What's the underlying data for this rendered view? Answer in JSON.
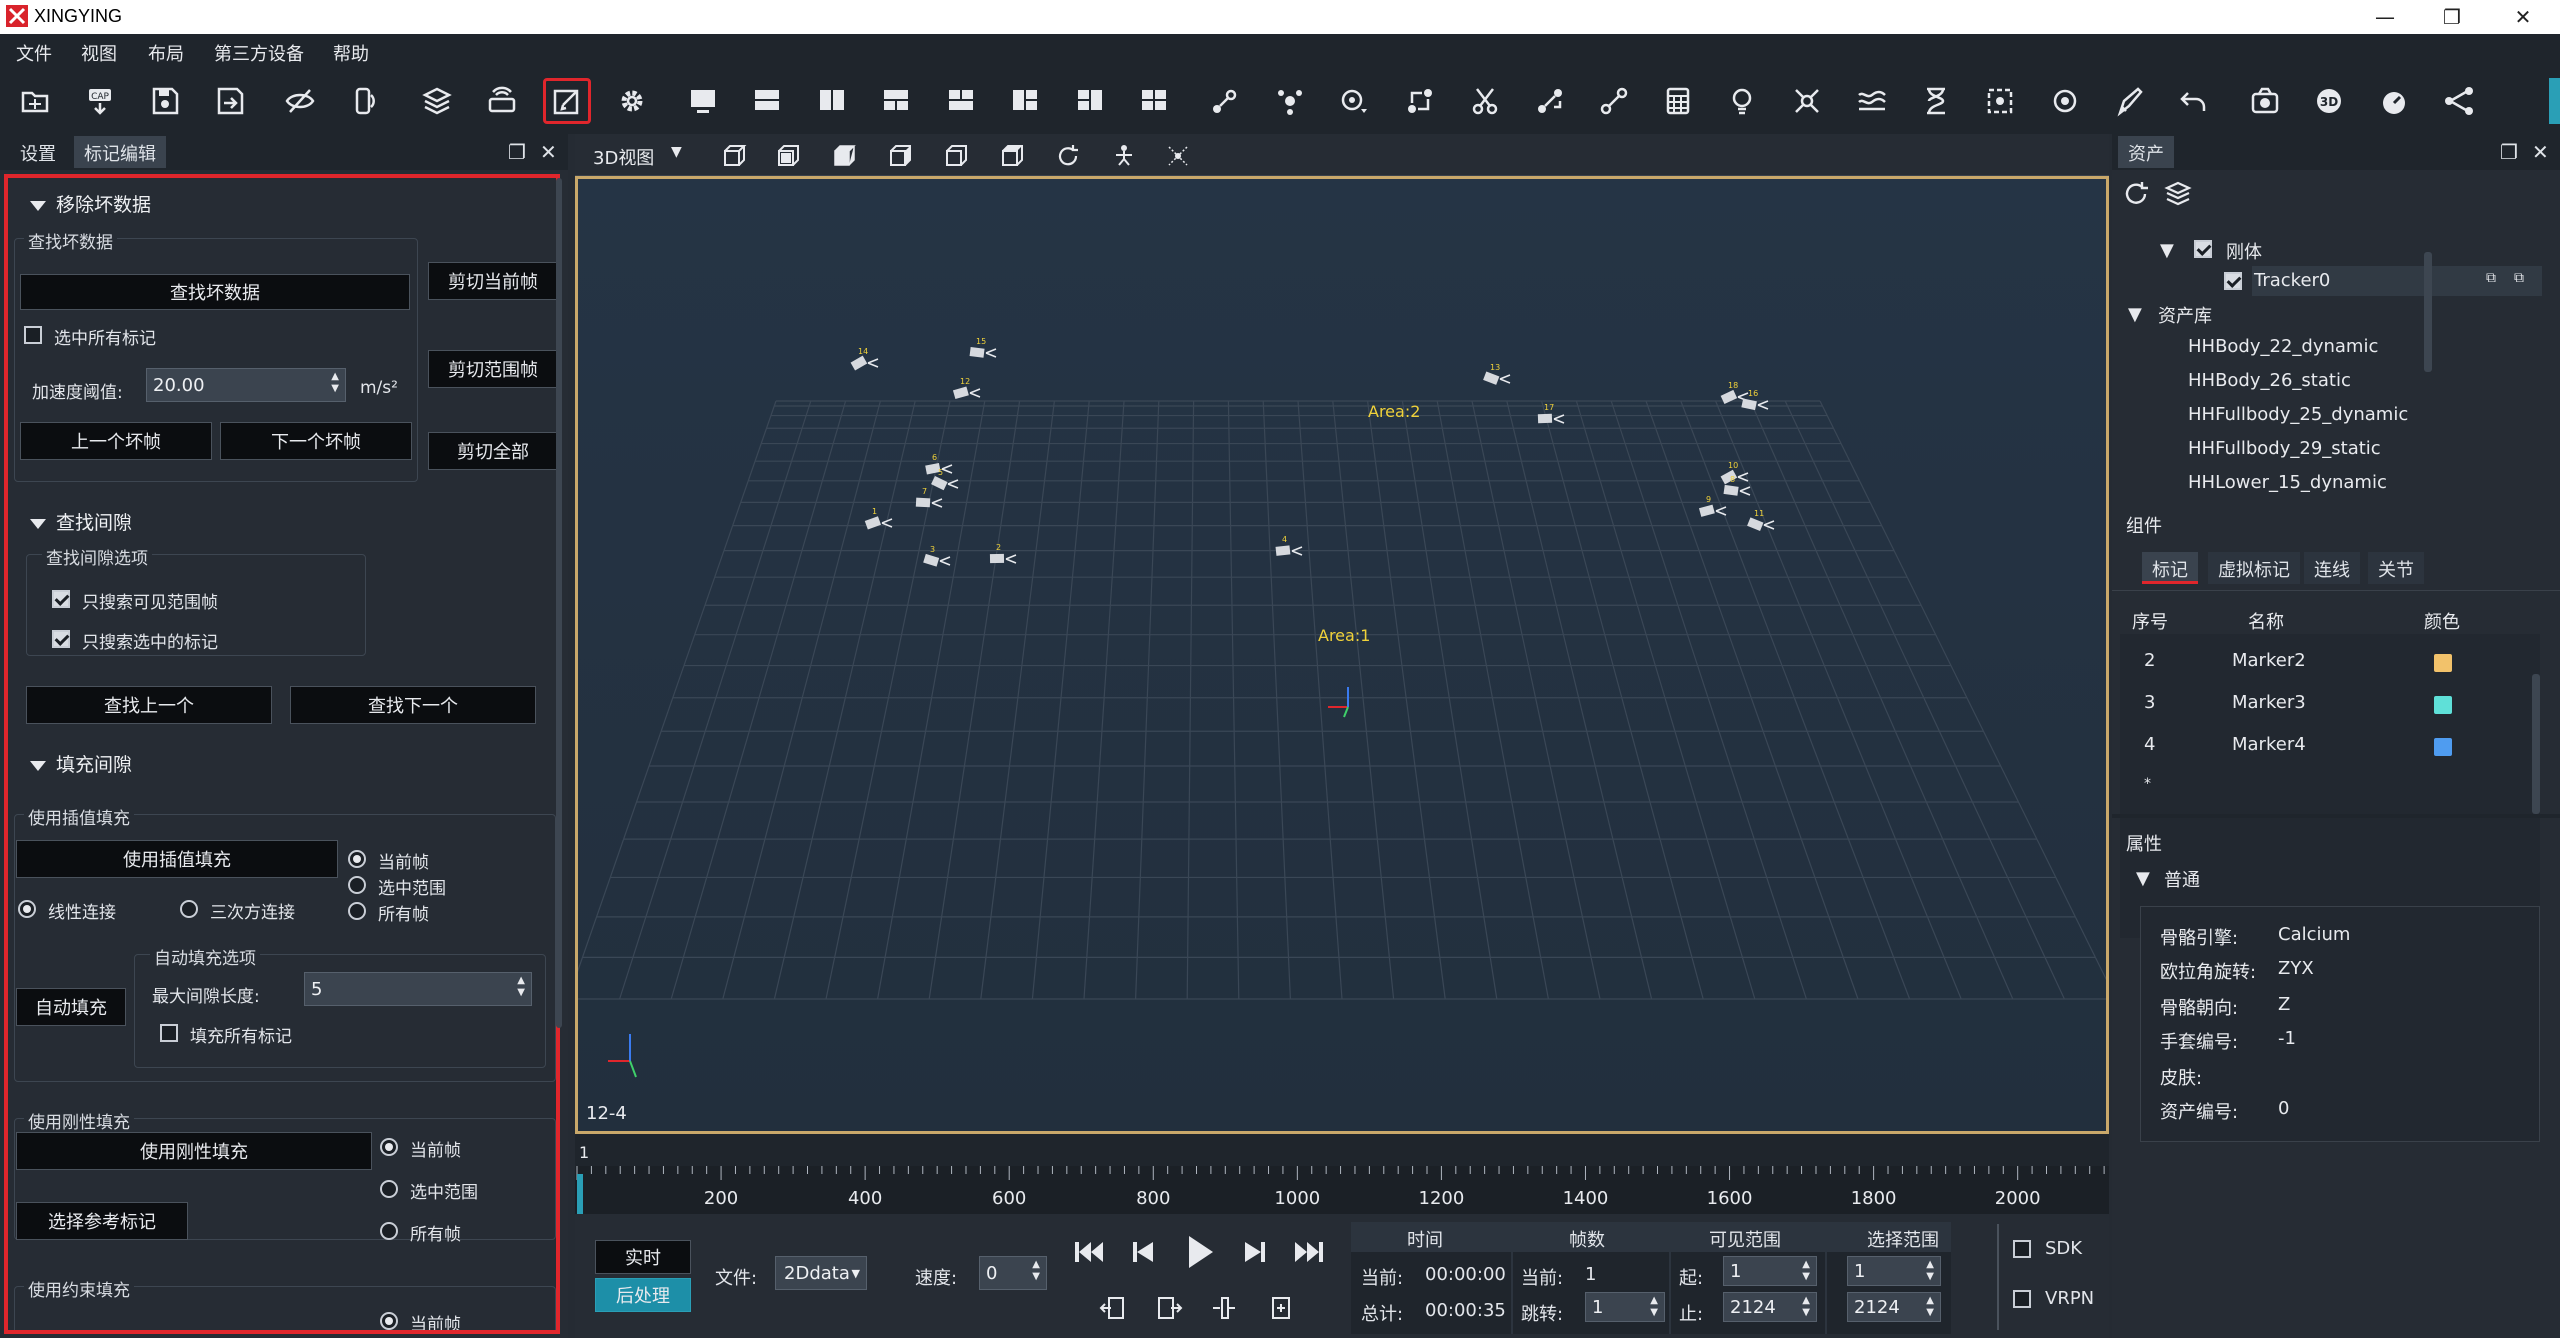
{
  "app": {
    "title": "XINGYING"
  },
  "window_controls": {
    "minimize": "—",
    "maximize": "❐",
    "close": "✕"
  },
  "menu": [
    "文件",
    "视图",
    "布局",
    "第三方设备",
    "帮助"
  ],
  "toolbar_icons": [
    "open-folder-icon",
    "cap-icon",
    "save-icon",
    "export-icon",
    "hide-icon",
    "device-icon",
    "layers-icon",
    "broadcast-icon",
    "edit-marker-icon",
    "settings-icon",
    "layout-single-icon",
    "layout-hsplit-icon",
    "layout-vsplit-icon",
    "layout-3a-icon",
    "layout-3b-icon",
    "layout-3c-icon",
    "layout-3d-icon",
    "layout-quad-icon",
    "link-marker-icon",
    "merge-icon",
    "track-icon",
    "swap-icon",
    "cut-icon",
    "join-icon",
    "connect-icon",
    "calculator-icon",
    "bulb-icon",
    "scatter-icon",
    "wave-icon",
    "hourglass-icon",
    "focus-icon",
    "record-icon",
    "pen-icon",
    "undo-icon",
    "camera-icon",
    "3d-icon",
    "speed-icon",
    "network-icon"
  ],
  "left_panel": {
    "tabs": [
      "设置",
      "标记编辑"
    ],
    "sections": {
      "remove_bad": {
        "title": "移除坏数据",
        "group_title": "查找坏数据",
        "find_button": "查找坏数据",
        "select_all_label": "选中所有标记",
        "accel_label": "加速度阈值:",
        "accel_value": "20.00",
        "accel_unit": "m/s²",
        "prev_button": "上一个坏帧",
        "next_button": "下一个坏帧",
        "cut_current": "剪切当前帧",
        "cut_range": "剪切范围帧",
        "cut_all": "剪切全部"
      },
      "find_gap": {
        "title": "查找间隙",
        "group_title": "查找间隙选项",
        "opt_visible": "只搜索可见范围帧",
        "opt_selected": "只搜索选中的标记",
        "prev_button": "查找上一个",
        "next_button": "查找下一个"
      },
      "fill_gap": {
        "title": "填充间隙",
        "interp_group": "使用插值填充",
        "interp_button": "使用插值填充",
        "linear": "线性连接",
        "cubic": "三次方连接",
        "current_frame": "当前帧",
        "selected_range": "选中范围",
        "all_frames": "所有帧",
        "auto_group": "自动填充选项",
        "auto_button": "自动填充",
        "max_gap_label": "最大间隙长度:",
        "max_gap_value": "5",
        "fill_all_label": "填充所有标记",
        "rigid_group": "使用刚性填充",
        "rigid_button": "使用刚性填充",
        "ref_button": "选择参考标记",
        "constraint_group": "使用约束填充"
      }
    }
  },
  "viewport": {
    "view_label": "3D视图",
    "area_labels": [
      "Area:2",
      "Area:1"
    ],
    "corner_label": "12-4",
    "camera_ids": [
      "14",
      "15",
      "12",
      "13",
      "17",
      "18",
      "16",
      "6",
      "5",
      "7",
      "1",
      "3",
      "4",
      "10",
      "8",
      "9",
      "11",
      "2"
    ]
  },
  "timeline": {
    "start_label": "1",
    "ticks": [
      "200",
      "400",
      "600",
      "800",
      "1000",
      "1200",
      "1400",
      "1600",
      "1800",
      "2000"
    ]
  },
  "controls": {
    "realtime": "实时",
    "post": "后处理",
    "file_label": "文件:",
    "file_value": "2Ddata",
    "speed_label": "速度:",
    "speed_value": "0",
    "headers": [
      "时间",
      "帧数",
      "可见范围",
      "选择范围"
    ],
    "time_current_label": "当前:",
    "time_current": "00:00:00",
    "time_total_label": "总计:",
    "time_total": "00:00:35",
    "frame_current_label": "当前:",
    "frame_current": "1",
    "frame_jump_label": "跳转:",
    "frame_jump": "1",
    "vis_start_label": "起:",
    "vis_start": "1",
    "vis_end_label": "止:",
    "vis_end": "2124",
    "sel_start": "1",
    "sel_end": "2124",
    "sdk": "SDK",
    "vrpn": "VRPN"
  },
  "right_panel": {
    "tab": "资产",
    "tree": {
      "rigid_label": "刚体",
      "tracker": "Tracker0",
      "library": "资产库",
      "items": [
        "HHBody_22_dynamic",
        "HHBody_26_static",
        "HHFullbody_25_dynamic",
        "HHFullbody_29_static",
        "HHLower_15_dynamic"
      ]
    },
    "component_title": "组件",
    "component_tabs": [
      "标记",
      "虚拟标记",
      "连线",
      "关节"
    ],
    "table_headers": [
      "序号",
      "名称",
      "颜色"
    ],
    "markers": [
      {
        "id": "2",
        "name": "Marker2",
        "color": "#f2c26b"
      },
      {
        "id": "3",
        "name": "Marker3",
        "color": "#5fe0d8"
      },
      {
        "id": "4",
        "name": "Marker4",
        "color": "#4f9cf0"
      }
    ],
    "new_row": "*",
    "props_title": "属性",
    "props_group": "普通",
    "props": [
      {
        "k": "骨骼引擎:",
        "v": "Calcium"
      },
      {
        "k": "欧拉角旋转:",
        "v": "ZYX"
      },
      {
        "k": "骨骼朝向:",
        "v": "Z"
      },
      {
        "k": "手套编号:",
        "v": "-1"
      },
      {
        "k": "皮肤:",
        "v": ""
      },
      {
        "k": "资产编号:",
        "v": "0"
      }
    ]
  },
  "colors": {
    "accent_red": "#e0262c",
    "highlight_yellow": "#f0d23a",
    "viewport_border": "#c9a86a",
    "timeline_blue": "#2a9fb6"
  }
}
